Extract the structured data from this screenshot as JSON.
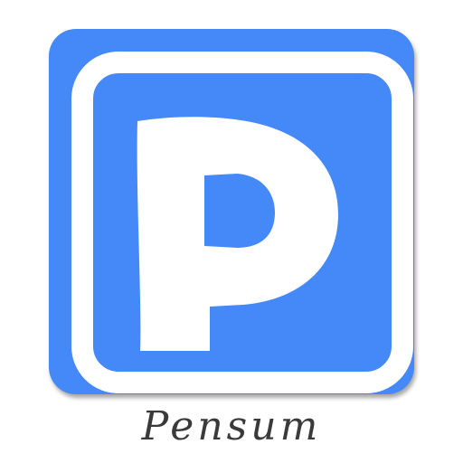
{
  "app": {
    "name": "Pensum",
    "icon": "parking-p-icon",
    "tile_color": "#4489f7",
    "glyph_color": "#ffffff"
  }
}
